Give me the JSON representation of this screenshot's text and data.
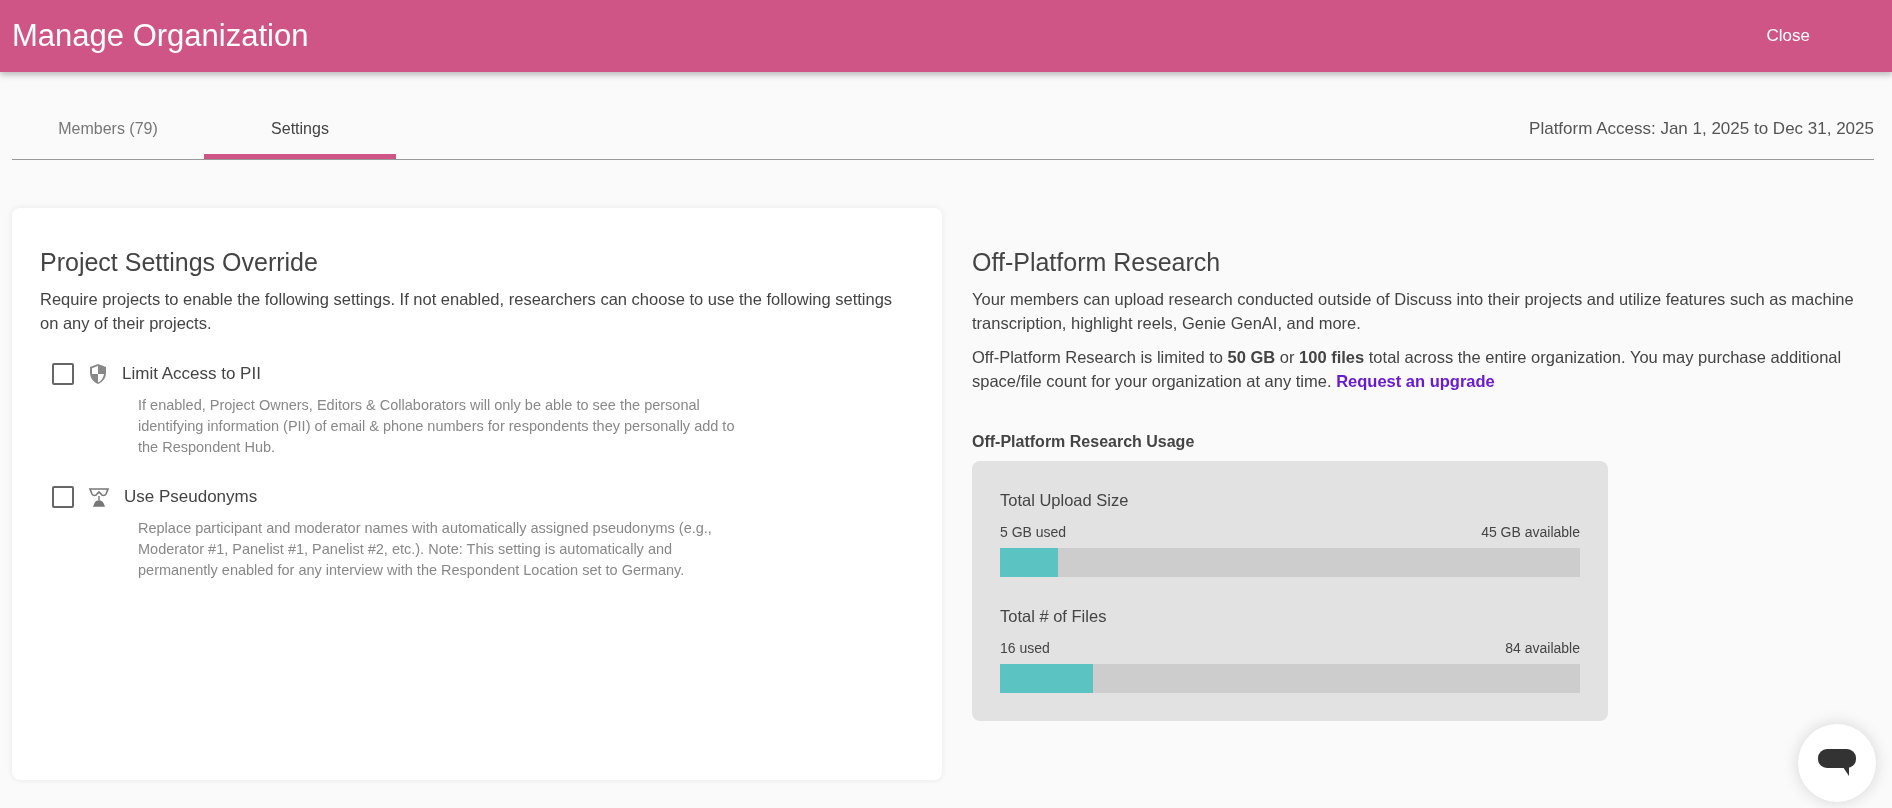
{
  "header": {
    "title": "Manage Organization",
    "close": "Close"
  },
  "tabs": [
    {
      "label": "Members (79)",
      "selected": false
    },
    {
      "label": "Settings",
      "selected": true
    }
  ],
  "platform_access": "Platform Access: Jan 1, 2025 to Dec 31, 2025",
  "project_settings": {
    "title": "Project Settings Override",
    "description": "Require projects to enable the following settings. If not enabled, researchers can choose to use the following settings on any of their projects.",
    "options": [
      {
        "kind": "shield",
        "label": "Limit Access to PII",
        "checked": false,
        "description": "If enabled, Project Owners, Editors & Collaborators will only be able to see the personal identifying information (PII) of email & phone numbers for respondents they personally add to the Respondent Hub."
      },
      {
        "kind": "mask",
        "label": "Use Pseudonyms",
        "checked": false,
        "description": "Replace participant and moderator names with automatically assigned pseudonyms (e.g., Moderator #1, Panelist #1, Panelist #2, etc.). Note: This setting is automatically and permanently enabled for any interview with the Respondent Location set to Germany."
      }
    ]
  },
  "off_platform": {
    "title": "Off-Platform Research",
    "paragraph_1": "Your members can upload research conducted outside of Discuss into their projects and utilize features such as machine transcription, highlight reels, Genie GenAI, and more.",
    "paragraph_2": "Off-Platform Research is limited to **50 GB** or **100 files** total across the entire organization. You may purchase additional space/file count for your organization at any time.",
    "link": "Request an upgrade",
    "usage_title": "Off-Platform Research Usage",
    "meters": [
      {
        "label": "Total Upload Size",
        "used": "5 GB used",
        "available": "45 GB available",
        "level": 0.1
      },
      {
        "label": "Total # of Files",
        "used": "16 used",
        "available": "84 available",
        "level": 0.16
      }
    ]
  }
}
